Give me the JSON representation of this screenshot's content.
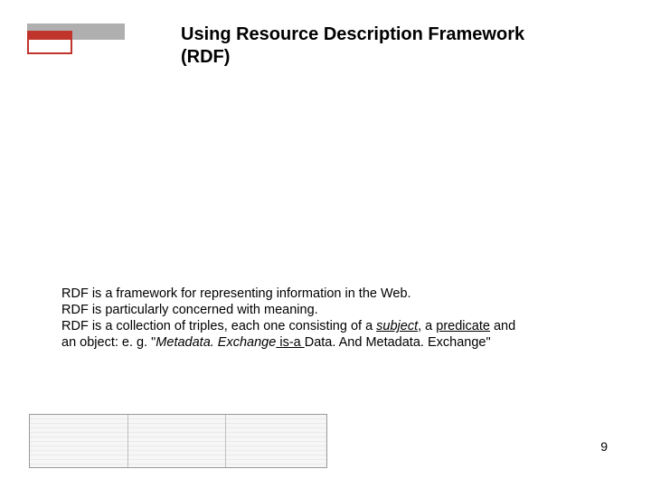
{
  "title": "Using Resource Description Framework (RDF)",
  "body": {
    "line1": "RDF is a framework for representing information in the Web.",
    "line2": "RDF is particularly concerned with meaning.",
    "line3_pre": "RDF is a collection of triples, each one consisting of a ",
    "subject_word": "subject",
    "line3_mid1": ", a ",
    "predicate_word": "predicate",
    "line3_mid2": " and",
    "line4_pre": " an object: e. g. \"",
    "example_subject": "Metadata. Exchange",
    "example_predicate": " is-a ",
    "example_object": "Data. And Metadata. Exchange\""
  },
  "page_number": "9"
}
